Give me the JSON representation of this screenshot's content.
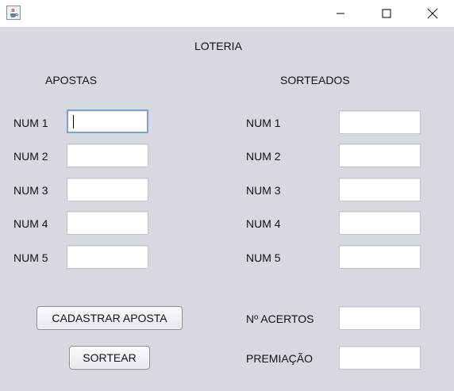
{
  "window": {
    "title_icon": "java-cup-icon"
  },
  "header": {
    "title": "LOTERIA"
  },
  "apostas": {
    "heading": "APOSTAS",
    "labels": [
      "NUM 1",
      "NUM 2",
      "NUM 3",
      "NUM 4",
      "NUM 5"
    ],
    "values": [
      "",
      "",
      "",
      "",
      ""
    ]
  },
  "sorteados": {
    "heading": "SORTEADOS",
    "labels": [
      "NUM 1",
      "NUM 2",
      "NUM 3",
      "NUM 4",
      "NUM 5"
    ],
    "values": [
      "",
      "",
      "",
      "",
      ""
    ]
  },
  "results": {
    "acertos_label": "Nº ACERTOS",
    "acertos_value": "",
    "premiacao_label": "PREMIAÇÃO",
    "premiacao_value": ""
  },
  "buttons": {
    "cadastrar": "CADASTRAR APOSTA",
    "sortear": "SORTEAR"
  }
}
